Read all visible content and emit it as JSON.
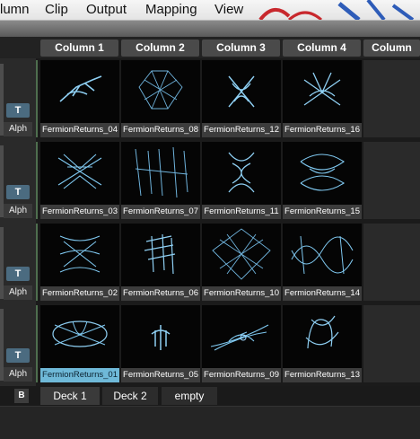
{
  "menu": [
    "lumn",
    "Clip",
    "Output",
    "Mapping",
    "View"
  ],
  "columns": [
    "Column 1",
    "Column 2",
    "Column 3",
    "Column 4",
    "Column"
  ],
  "layer_labels": {
    "t": "T",
    "alph": "Alph"
  },
  "rows": [
    [
      "FermionReturns_04",
      "FermionReturns_08",
      "FermionReturns_12",
      "FermionReturns_16"
    ],
    [
      "FermionReturns_03",
      "FermionReturns_07",
      "FermionReturns_11",
      "FermionReturns_15"
    ],
    [
      "FermionReturns_02",
      "FermionReturns_06",
      "FermionReturns_10",
      "FermionReturns_14"
    ],
    [
      "FermionReturns_01",
      "FermionReturns_05",
      "FermionReturns_09",
      "FermionReturns_13"
    ]
  ],
  "selected_clip": "FermionReturns_01",
  "bottom": {
    "b": "B",
    "decks": [
      "Deck 1",
      "Deck 2",
      "empty"
    ]
  },
  "colors": {
    "accent": "#6fb9d8",
    "clip_stroke": "#7fc8f0"
  }
}
